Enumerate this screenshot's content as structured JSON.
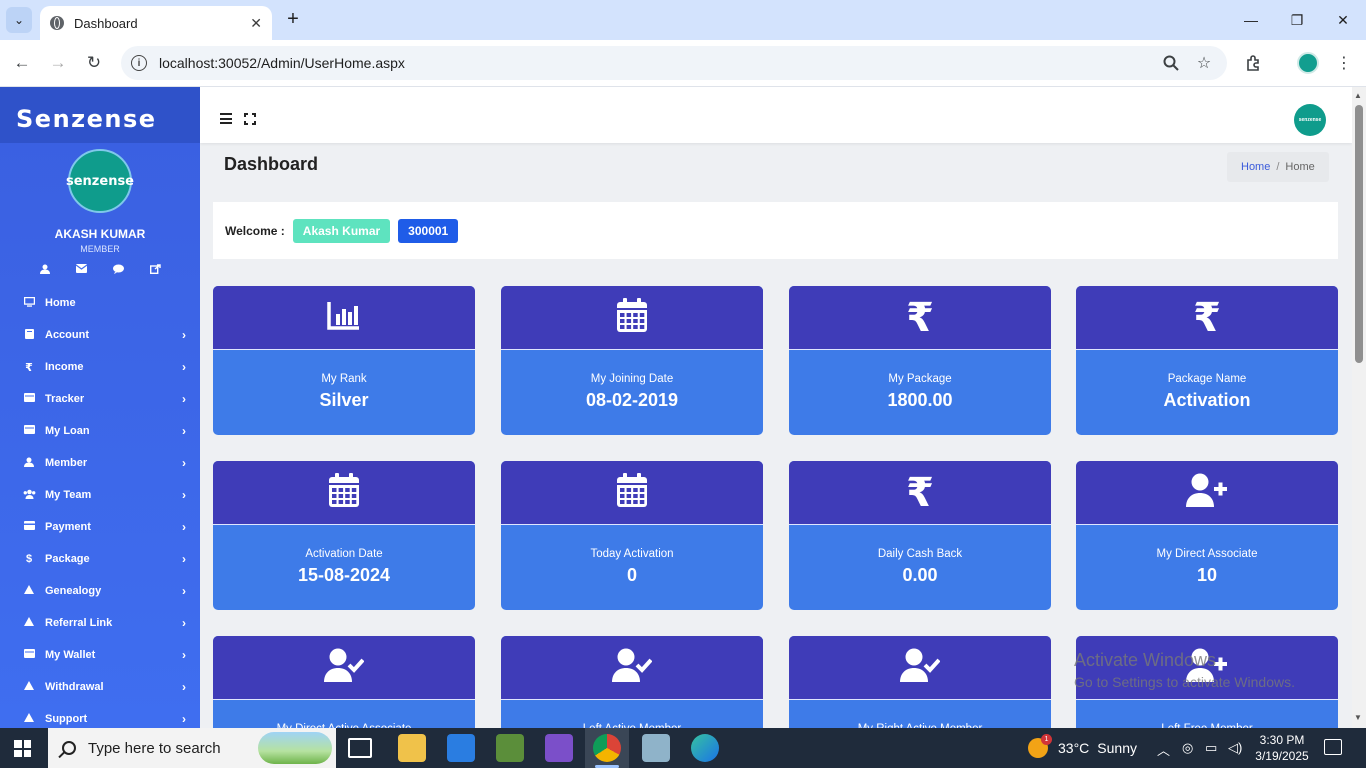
{
  "browser": {
    "tab_title": "Dashboard",
    "url": "localhost:30052/Admin/UserHome.aspx"
  },
  "sidebar": {
    "brand": "Senzense",
    "logo_text": "senzense",
    "user_name": "AKASH KUMAR",
    "user_role": "MEMBER",
    "items": [
      {
        "label": "Home",
        "icon": "monitor-icon",
        "has_children": false
      },
      {
        "label": "Account",
        "icon": "book-icon",
        "has_children": true
      },
      {
        "label": "Income",
        "icon": "rupee-icon",
        "has_children": true
      },
      {
        "label": "Tracker",
        "icon": "folder-icon",
        "has_children": true
      },
      {
        "label": "My Loan",
        "icon": "folder-icon",
        "has_children": true
      },
      {
        "label": "Member",
        "icon": "user-icon",
        "has_children": true
      },
      {
        "label": "My Team",
        "icon": "users-icon",
        "has_children": true
      },
      {
        "label": "Payment",
        "icon": "card-icon",
        "has_children": true
      },
      {
        "label": "Package",
        "icon": "dollar-icon",
        "has_children": true
      },
      {
        "label": "Genealogy",
        "icon": "triangle-icon",
        "has_children": true
      },
      {
        "label": "Referral Link",
        "icon": "triangle-icon",
        "has_children": true
      },
      {
        "label": "My Wallet",
        "icon": "folder-icon",
        "has_children": true
      },
      {
        "label": "Withdrawal",
        "icon": "triangle-icon",
        "has_children": true
      },
      {
        "label": "Support",
        "icon": "triangle-icon",
        "has_children": true
      }
    ]
  },
  "header": {
    "page_title": "Dashboard",
    "breadcrumb": [
      "Home",
      "Home"
    ],
    "logo_text": "senzense"
  },
  "welcome": {
    "label": "Welcome :",
    "name": "Akash Kumar",
    "member_id": "300001"
  },
  "cards": [
    {
      "label": "My Rank",
      "value": "Silver",
      "icon": "bar-chart-icon"
    },
    {
      "label": "My Joining Date",
      "value": "08-02-2019",
      "icon": "calendar-icon"
    },
    {
      "label": "My Package",
      "value": "1800.00",
      "icon": "rupee-icon"
    },
    {
      "label": "Package Name",
      "value": "Activation",
      "icon": "rupee-icon"
    },
    {
      "label": "Activation Date",
      "value": "15-08-2024",
      "icon": "calendar-icon"
    },
    {
      "label": "Today Activation",
      "value": "0",
      "icon": "calendar-icon"
    },
    {
      "label": "Daily Cash Back",
      "value": "0.00",
      "icon": "rupee-icon"
    },
    {
      "label": "My Direct Associate",
      "value": "10",
      "icon": "user-plus-icon"
    },
    {
      "label": "My Direct Active Associate",
      "value": "",
      "icon": "user-check-icon"
    },
    {
      "label": "Left Active Member",
      "value": "",
      "icon": "user-check-icon"
    },
    {
      "label": "My Right Active Member",
      "value": "",
      "icon": "user-check-icon"
    },
    {
      "label": "Left Free Member",
      "value": "",
      "icon": "user-plus-icon"
    }
  ],
  "watermark": {
    "line1": "Activate Windows",
    "line2": "Go to Settings to activate Windows."
  },
  "taskbar": {
    "search_placeholder": "Type here to search",
    "weather_temp": "33°C",
    "weather_text": "Sunny",
    "weather_badge": "1",
    "time": "3:30 PM",
    "date": "3/19/2025"
  },
  "colors": {
    "sidebar": "#3f6ef0",
    "card_top": "#3f3cb8",
    "card_body": "#3e7be8",
    "badge_name": "#5ee3bf",
    "badge_id": "#1f5ce8"
  }
}
